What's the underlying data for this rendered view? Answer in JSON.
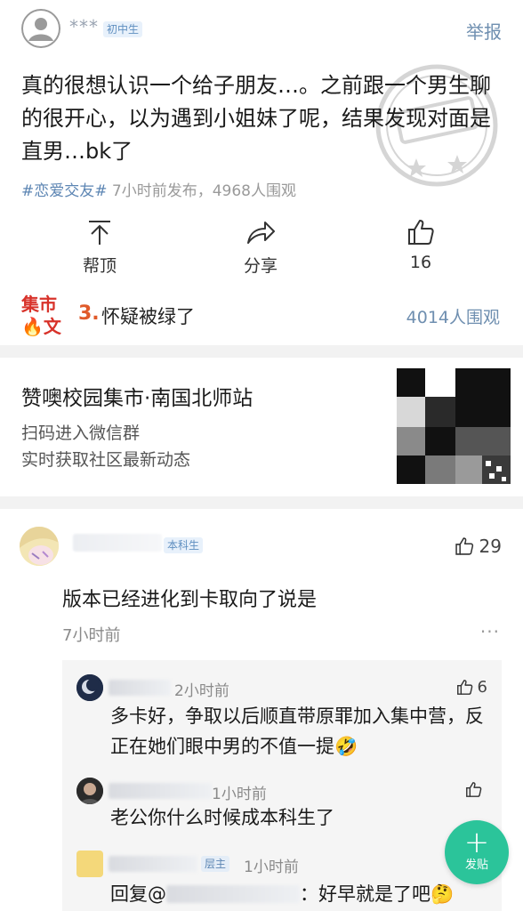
{
  "post": {
    "author_name": "***",
    "author_badge": "初中生",
    "report_label": "举报",
    "body": "真的很想认识一个给子朋友…。之前跟一个男生聊的很开心，以为遇到小姐妹了呢，结果发现对面是直男…bk了",
    "tag": "#恋爱交友#",
    "meta": " 7小时前发布，4968人围观"
  },
  "actions": {
    "top_label": "帮顶",
    "share_label": "分享",
    "like_count": "16"
  },
  "hot": {
    "logo_line1": "集市",
    "logo_line2": "文",
    "rank": "3.",
    "title": "怀疑被绿了",
    "views": "4014人围观"
  },
  "ad": {
    "title": "赞噢校园集市·南国北师站",
    "line1": "扫码进入微信群",
    "line2": "实时获取社区最新动态"
  },
  "comment": {
    "badge": "本科生",
    "like_count": "29",
    "text": "版本已经进化到卡取向了说是",
    "time": "7小时前",
    "more": "···"
  },
  "replies": [
    {
      "time": "2小时前",
      "like_count": "6",
      "text": "多卡好，争取以后顺直带原罪加入集中营，反正在她们眼中男的不值一提🤣"
    },
    {
      "time": "1小时前",
      "like_count": "",
      "text": "老公你什么时候成本科生了"
    },
    {
      "badge": "层主",
      "time": "1小时前",
      "text_prefix": "回复@",
      "text_sep": "：",
      "text": "好早就是了吧🤔"
    }
  ],
  "fab": {
    "label": "发贴"
  },
  "colors": {
    "accent": "#2bc49a",
    "link": "#6f8fb0",
    "hot": "#e05a2a"
  },
  "icons": [
    "user-icon",
    "up-arrow-icon",
    "share-arrow-icon",
    "thumbs-up-icon",
    "more-dots-icon",
    "plus-icon"
  ]
}
